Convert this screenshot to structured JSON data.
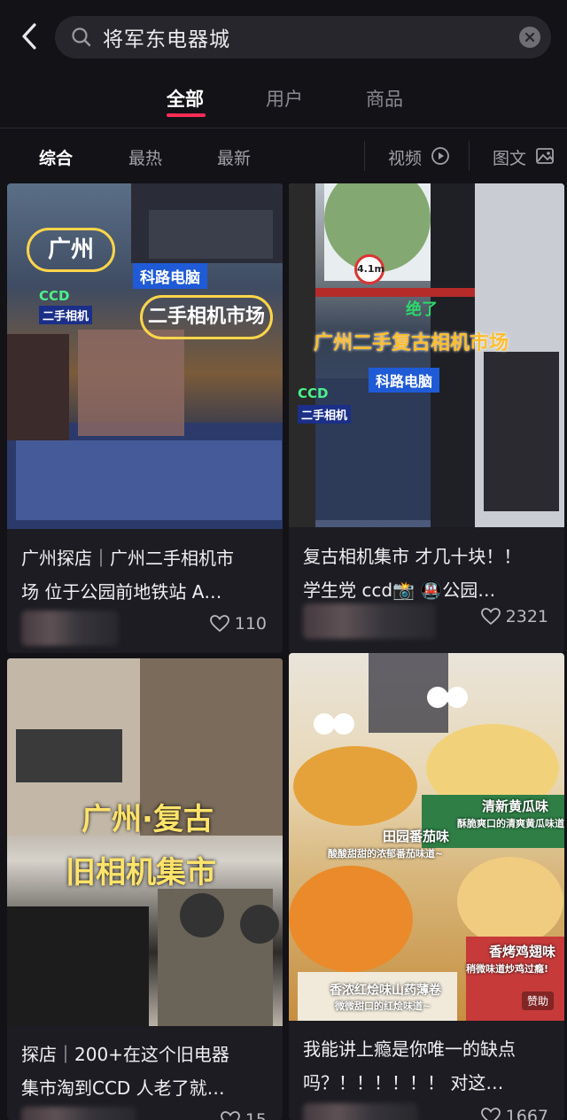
{
  "search": {
    "query": "将军东电器城"
  },
  "tabs": [
    "全部",
    "用户",
    "商品"
  ],
  "filters": {
    "comprehensive": "综合",
    "hottest": "最热",
    "newest": "最新",
    "video": "视频",
    "image_text": "图文"
  },
  "colors": {
    "accent": "#fe2c55",
    "background": "#121217",
    "card": "#1c1c22"
  },
  "cards": [
    {
      "title_line1": "广州探店｜广州二手相机市",
      "title_line2": "场 位于公园前地铁站 A…",
      "likes": "110",
      "overlay": {
        "tag1": "广州",
        "tag2": "二手相机市场",
        "sign1": "科路电脑",
        "sign2": "CCD",
        "sign3": "二手相机"
      }
    },
    {
      "title_line1": "复古相机集市 才几十块！！",
      "title_line2": "学生党 ccd📸 🚇公园…",
      "likes": "2321",
      "overlay": {
        "headline": "广州二手复古相机市场",
        "exclaim": "绝了",
        "sign1": "科路电脑",
        "sign2": "CCD",
        "sign3": "二手相机",
        "height_sign": "4.1m"
      }
    },
    {
      "title_line1": "探店｜200+在这个旧电器",
      "title_line2": "集市淘到CCD 人老了就…",
      "likes": "15",
      "overlay": {
        "line1": "广州·复古",
        "line2": "旧相机集市"
      }
    },
    {
      "title_line1": "我能讲上瘾是你唯一的缺点",
      "title_line2": "吗？！！！！！！ 对这…",
      "likes": "1667",
      "overlay": {
        "l1": "清新黄瓜味",
        "l1s": "酥脆爽口的清爽黄瓜味道~",
        "l2": "田园番茄味",
        "l2s": "酸酸甜甜的浓郁番茄味道~",
        "l3": "香烤鸡翅味",
        "l3s": "稍微味道炒鸡过瘾!",
        "l4": "香浓红烩味山药薄卷",
        "l4s": "微微甜口的红烩味道~",
        "sponsored": "赞助"
      }
    }
  ]
}
